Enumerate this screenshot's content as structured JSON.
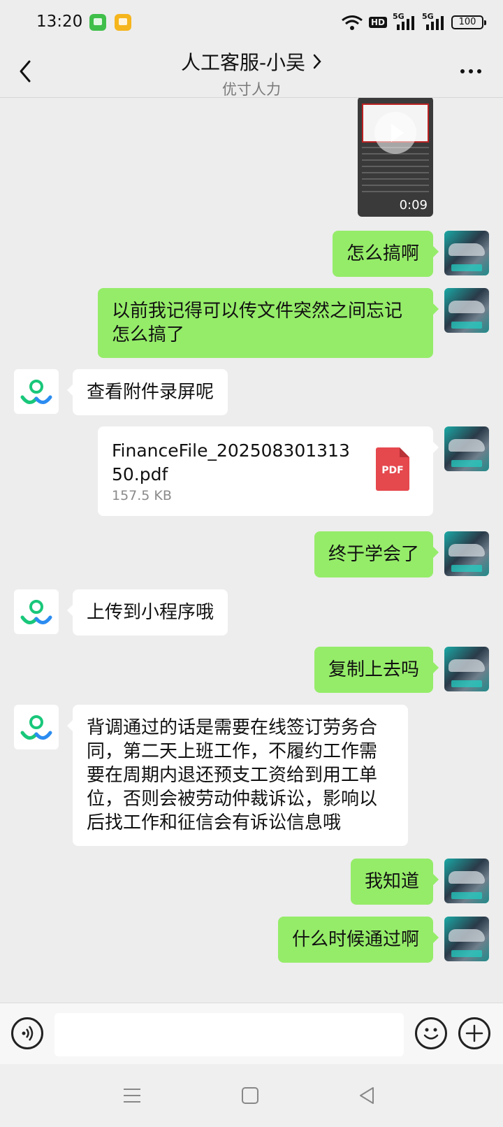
{
  "status_bar": {
    "time": "13:20",
    "hd_label": "HD",
    "net1": "5G",
    "net2": "5G",
    "battery": "100",
    "icons": [
      "messages-app-icon",
      "reader-app-icon",
      "wifi-icon",
      "signal-icon",
      "battery-icon"
    ]
  },
  "header": {
    "title": "人工客服-小吴",
    "subtitle": "优寸人力"
  },
  "messages": [
    {
      "from": "self",
      "type": "video",
      "duration": "0:09"
    },
    {
      "from": "self",
      "type": "text",
      "text": "怎么搞啊"
    },
    {
      "from": "self",
      "type": "text",
      "text": "以前我记得可以传文件突然之间忘记怎么搞了"
    },
    {
      "from": "agent",
      "type": "text",
      "text": "查看附件录屏呢"
    },
    {
      "from": "self",
      "type": "file",
      "file_name": "FinanceFile_20250830131350.pdf",
      "file_size": "157.5 KB",
      "file_type": "PDF"
    },
    {
      "from": "self",
      "type": "text",
      "text": "终于学会了"
    },
    {
      "from": "agent",
      "type": "text",
      "text": "上传到小程序哦"
    },
    {
      "from": "self",
      "type": "text",
      "text": "复制上去吗"
    },
    {
      "from": "agent",
      "type": "text",
      "text": "背调通过的话是需要在线签订劳务合同，第二天上班工作，不履约工作需要在周期内退还预支工资给到用工单位，否则会被劳动仲裁诉讼，影响以后找工作和征信会有诉讼信息哦"
    },
    {
      "from": "self",
      "type": "text",
      "text": "我知道"
    },
    {
      "from": "self",
      "type": "text",
      "text": "什么时候通过啊"
    }
  ],
  "input": {
    "value": "",
    "placeholder": ""
  },
  "colors": {
    "background": "#ededed",
    "self_bubble": "#95ec69",
    "agent_bubble": "#ffffff",
    "agent_logo_green": "#19c77a",
    "agent_logo_blue": "#2b8cf0",
    "pdf_red": "#e5484d"
  }
}
